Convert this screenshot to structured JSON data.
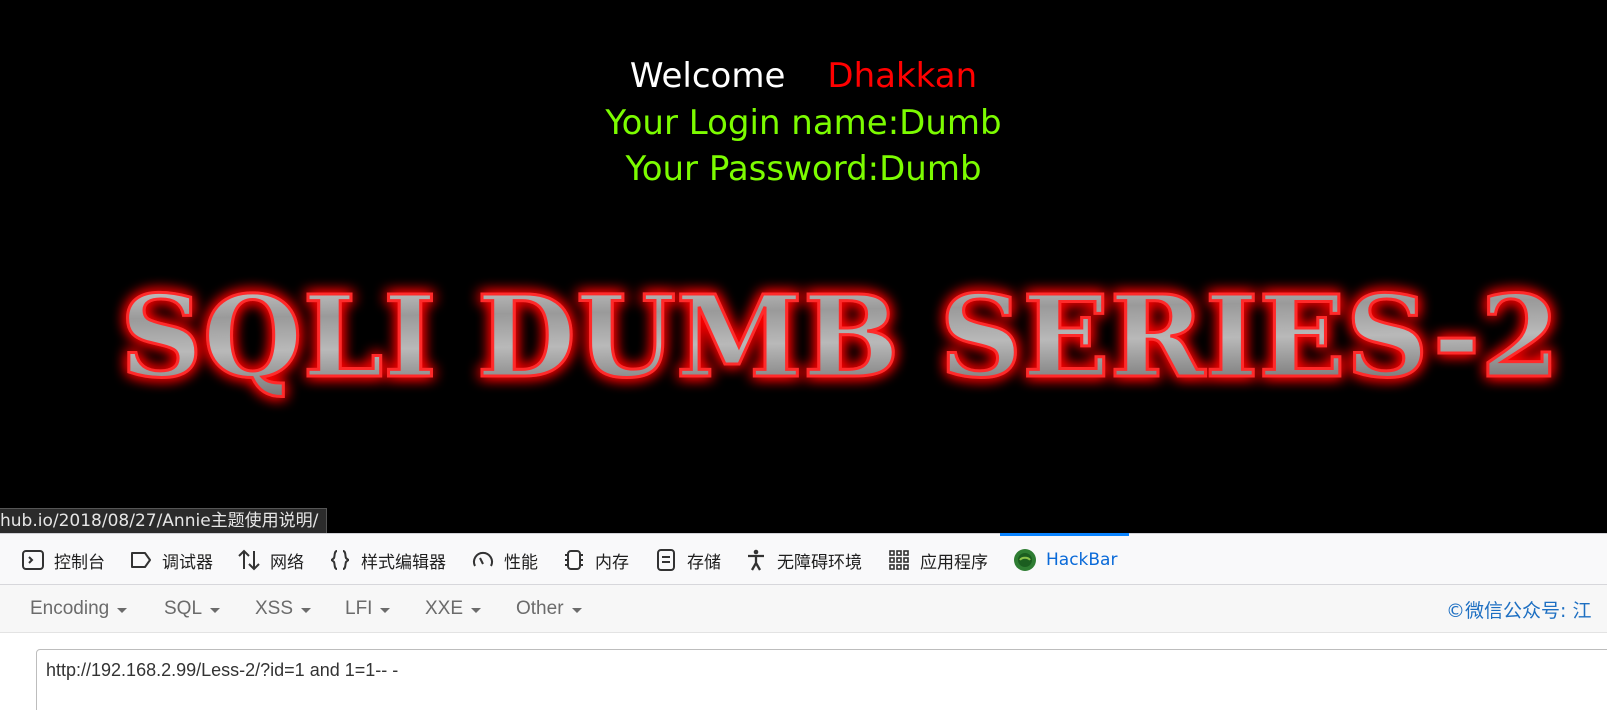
{
  "page": {
    "welcome_word": "Welcome",
    "welcome_name": "Dhakkan",
    "login_line": "Your Login name:Dumb",
    "password_line": "Your Password:Dumb",
    "banner_text": "SQLI DUMB SERIES-2"
  },
  "status_bar": {
    "url": "hub.io/2018/08/27/Annie主题使用说明/"
  },
  "devtools": {
    "tabs": [
      {
        "label": "控制台",
        "icon": "console-icon"
      },
      {
        "label": "调试器",
        "icon": "debugger-icon"
      },
      {
        "label": "网络",
        "icon": "network-icon"
      },
      {
        "label": "样式编辑器",
        "icon": "style-editor-icon"
      },
      {
        "label": "性能",
        "icon": "performance-icon"
      },
      {
        "label": "内存",
        "icon": "memory-icon"
      },
      {
        "label": "存储",
        "icon": "storage-icon"
      },
      {
        "label": "无障碍环境",
        "icon": "accessibility-icon"
      },
      {
        "label": "应用程序",
        "icon": "application-icon"
      },
      {
        "label": "HackBar",
        "icon": "hackbar-icon",
        "active": true
      }
    ]
  },
  "hackbar": {
    "menus": [
      {
        "label": "Encoding"
      },
      {
        "label": "SQL"
      },
      {
        "label": "XSS"
      },
      {
        "label": "LFI"
      },
      {
        "label": "XXE"
      },
      {
        "label": "Other"
      }
    ],
    "credit": "©微信公众号: 江",
    "url_value": "http://192.168.2.99/Less-2/?id=1 and 1=1-- -"
  },
  "colors": {
    "background": "#000000",
    "welcome": "#ffffff",
    "name": "#ff0000",
    "login_text": "#7cfc00",
    "active_tab": "#0a84ff",
    "credit": "#1d6fc2"
  }
}
